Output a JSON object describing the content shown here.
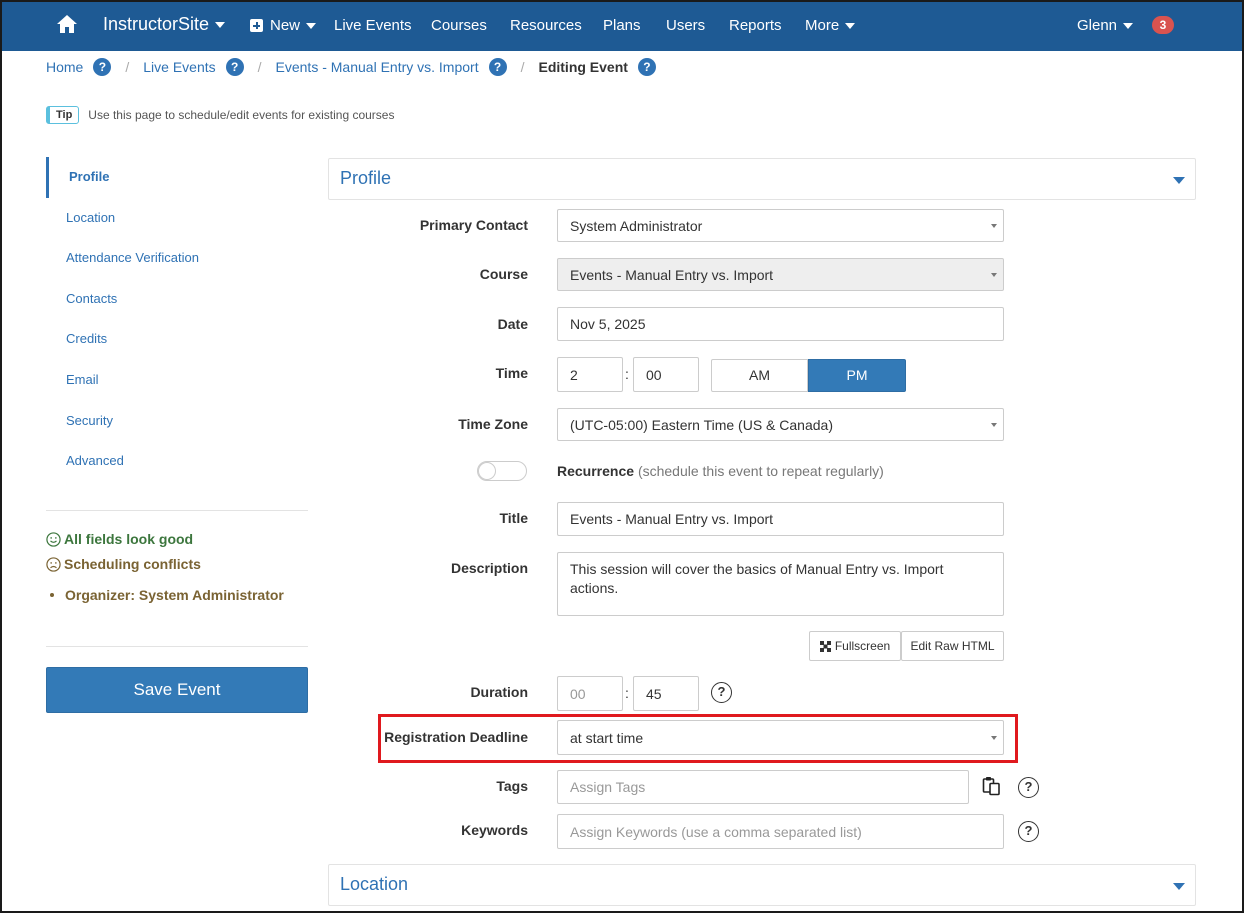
{
  "navbar": {
    "brand": "InstructorSite",
    "new_label": "New",
    "items": [
      "Live Events",
      "Courses",
      "Resources",
      "Plans",
      "Users",
      "Reports"
    ],
    "more_label": "More",
    "user_label": "Glenn",
    "notification_count": "3"
  },
  "breadcrumb": {
    "items": [
      "Home",
      "Live Events",
      "Events - Manual Entry vs. Import"
    ],
    "current": "Editing Event",
    "help_glyph": "?"
  },
  "tip": {
    "badge": "Tip",
    "text": "Use this page to schedule/edit events for existing courses"
  },
  "sidebar": {
    "items": [
      "Profile",
      "Location",
      "Attendance Verification",
      "Contacts",
      "Credits",
      "Email",
      "Security",
      "Advanced"
    ],
    "active_index": 0,
    "status_good": "All fields look good",
    "status_warn": "Scheduling conflicts",
    "conflict_item": "Organizer: System Administrator",
    "save_label": "Save Event"
  },
  "panels": {
    "profile_title": "Profile",
    "location_title": "Location"
  },
  "form": {
    "primary_contact": {
      "label": "Primary Contact",
      "value": "System Administrator"
    },
    "course": {
      "label": "Course",
      "value": "Events - Manual Entry vs. Import"
    },
    "date": {
      "label": "Date",
      "value": "Nov 5, 2025"
    },
    "time": {
      "label": "Time",
      "hour": "2",
      "minute": "00",
      "am": "AM",
      "pm": "PM",
      "selected": "PM"
    },
    "time_zone": {
      "label": "Time Zone",
      "value": "(UTC-05:00) Eastern Time (US & Canada)"
    },
    "recurrence": {
      "label": "Recurrence",
      "hint": "(schedule this event to repeat regularly)",
      "enabled": false
    },
    "title": {
      "label": "Title",
      "value": "Events - Manual Entry vs. Import"
    },
    "description": {
      "label": "Description",
      "value": "This session will cover the basics of Manual Entry vs. Import actions.",
      "fullscreen_label": "Fullscreen",
      "raw_html_label": "Edit Raw HTML"
    },
    "duration": {
      "label": "Duration",
      "hours_placeholder": "00",
      "minutes": "45"
    },
    "registration_deadline": {
      "label": "Registration Deadline",
      "value": "at start time"
    },
    "tags": {
      "label": "Tags",
      "placeholder": "Assign Tags"
    },
    "keywords": {
      "label": "Keywords",
      "placeholder": "Assign Keywords (use a comma separated list)"
    },
    "help_glyph": "?",
    "colon": ":"
  },
  "colors": {
    "navbar": "#1e5a94",
    "link": "#2f72b4",
    "primary_button": "#337ab7",
    "highlight": "#e0191e",
    "good": "#3c763d",
    "warn": "#7a6333"
  },
  "icons": [
    "home-icon",
    "plus-square-icon",
    "caret-down-icon",
    "question-circle-icon",
    "smile-icon",
    "frown-icon",
    "expand-icon",
    "clipboard-icon"
  ]
}
